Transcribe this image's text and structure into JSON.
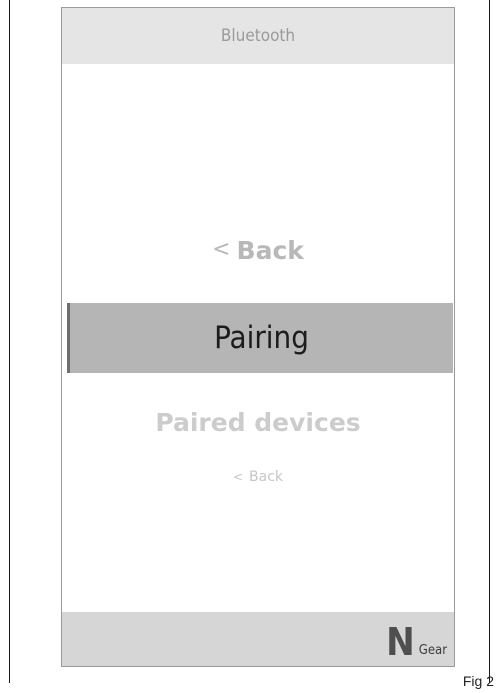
{
  "header": {
    "title": "Bluetooth"
  },
  "menu": {
    "back_top": {
      "chevron": "<",
      "label": "Back"
    },
    "selected": {
      "label": "Pairing"
    },
    "paired": {
      "label": "Paired devices"
    },
    "back_bottom": {
      "chevron": "<",
      "label": "Back"
    }
  },
  "footer": {
    "gear_value": "N",
    "gear_label": "Gear"
  },
  "figure": {
    "label": "Fig 2"
  }
}
